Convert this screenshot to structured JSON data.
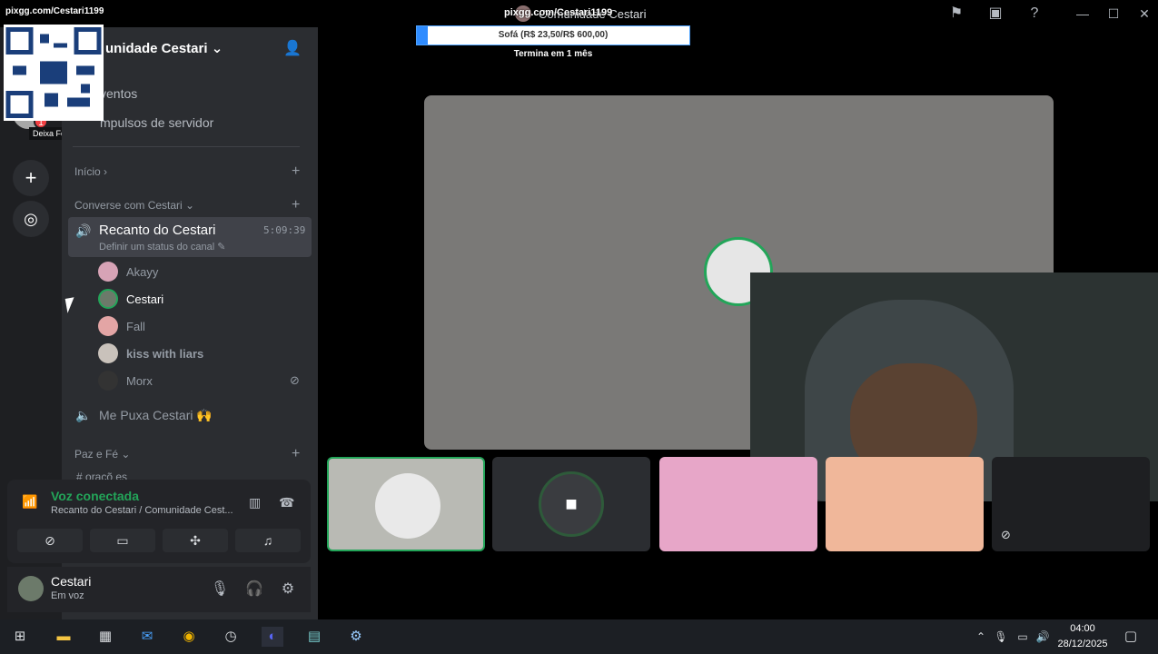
{
  "window": {
    "title": "Comunidade Cestari"
  },
  "overlay": {
    "url": "pixgg.com/Cestari1199",
    "goal_label": "pixgg.com/Cestari1199",
    "goal_text": "Sofá (R$ 23,50/R$ 600,00)",
    "goal_progress": 0.039,
    "goal_sub": "Termina em 1 mês"
  },
  "rail": {
    "tooltip": "Deixa Forte",
    "badge": "1"
  },
  "server": {
    "name": "unidade Cestari"
  },
  "sidebar": {
    "items": [
      {
        "label": "ventos"
      },
      {
        "label": "mpulsos de servidor"
      }
    ],
    "categories": [
      {
        "label": "Início"
      },
      {
        "label": "Converse com Cestari"
      },
      {
        "label": "Paz e Fé"
      }
    ],
    "voice_channel": {
      "name": "Recanto do Cestari",
      "status": "Definir um status do canal",
      "time": "5:09:39"
    },
    "voice_users": [
      {
        "name": "Akayy",
        "color": "#d7a3b6"
      },
      {
        "name": "Cestari",
        "color": "#6c7a6a"
      },
      {
        "name": "Fall",
        "color": "#e3a5a5"
      },
      {
        "name": "kiss with liars",
        "color": "#c9c2bb"
      },
      {
        "name": "Morx",
        "color": "#333"
      }
    ],
    "voice_channel_2": {
      "name": "Me Puxa Cestari 🙌"
    },
    "partial_channel": "oraçõ es"
  },
  "voice_panel": {
    "title": "Voz conectada",
    "subtitle": "Recanto do Cestari / Comunidade Cest..."
  },
  "user_panel": {
    "name": "Cestari",
    "status": "Em voz"
  },
  "taskbar": {
    "time": "04:00",
    "date": "28/12/2025"
  }
}
